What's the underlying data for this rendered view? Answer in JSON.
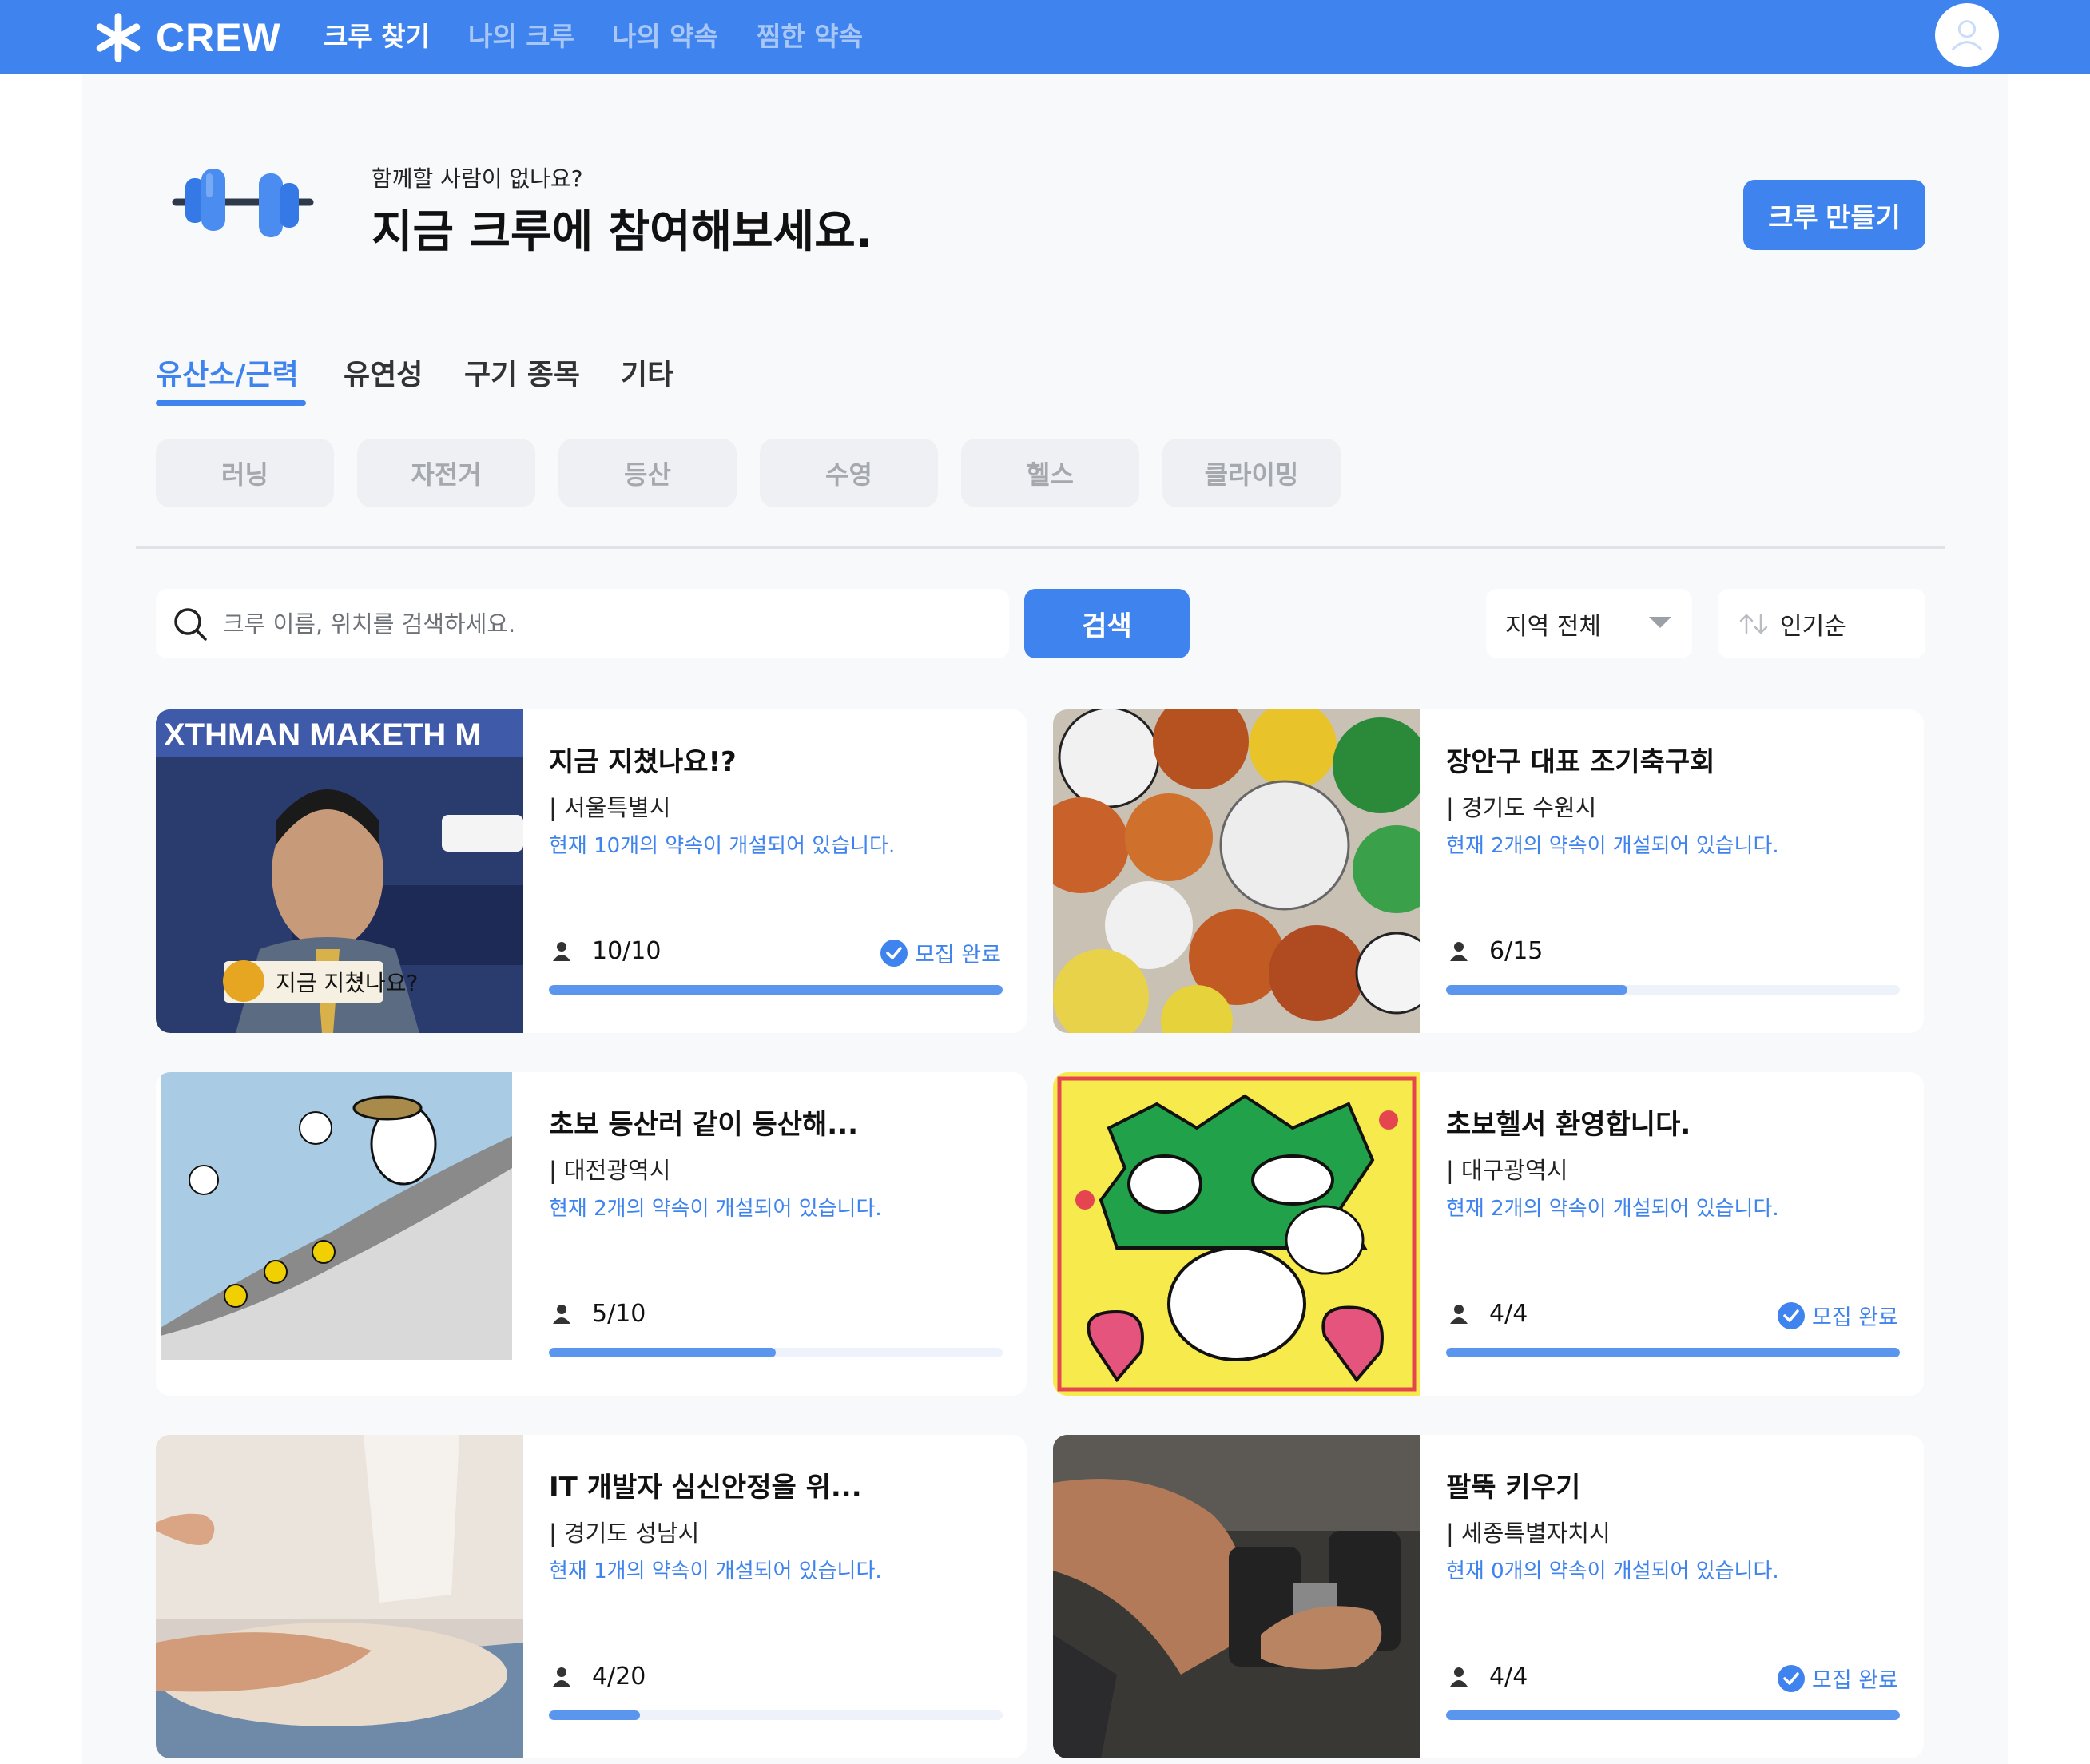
{
  "brand": {
    "name": "CREW",
    "accent": "#3f83ee"
  },
  "nav": {
    "items": [
      {
        "label": "크루 찾기",
        "active": true
      },
      {
        "label": "나의 크루",
        "active": false
      },
      {
        "label": "나의 약속",
        "active": false
      },
      {
        "label": "찜한 약속",
        "active": false
      }
    ]
  },
  "profile": {
    "icon": "user-avatar-icon"
  },
  "hero": {
    "subtitle": "함께할 사람이 없나요?",
    "title": "지금 크루에 참여해보세요.",
    "create_button": "크루 만들기",
    "icon": "dumbbell-icon"
  },
  "categories": {
    "tabs": [
      {
        "label": "유산소/근력",
        "active": true
      },
      {
        "label": "유연성",
        "active": false
      },
      {
        "label": "구기 종목",
        "active": false
      },
      {
        "label": "기타",
        "active": false
      }
    ],
    "chips": [
      "러닝",
      "자전거",
      "등산",
      "수영",
      "헬스",
      "클라이밍"
    ]
  },
  "search": {
    "placeholder": "크루 이름, 위치를 검색하세요.",
    "value": "",
    "button": "검색",
    "region": "지역 전체",
    "sort": "인기순"
  },
  "crews": [
    {
      "title": "지금 지쳤나요!?",
      "location": "| 서울특별시",
      "description": "현재 10개의 약속이 개설되어 있습니다.",
      "members": "10/10",
      "fill": 1.0,
      "status": "모집 완료",
      "closed": true,
      "image": "meme-image",
      "image_caption": "지금 지쳤나요?"
    },
    {
      "title": "장안구 대표 조기축구회",
      "location": "| 경기도 수원시",
      "description": "현재 2개의 약속이 개설되어 있습니다.",
      "members": "6/15",
      "fill": 0.4,
      "status": "",
      "closed": false,
      "image": "sports-balls-image"
    },
    {
      "title": "초보 등산러 같이 등산해...",
      "location": "| 대전광역시",
      "description": "현재 2개의 약속이 개설되어 있습니다.",
      "members": "5/10",
      "fill": 0.5,
      "status": "",
      "closed": false,
      "image": "snoopy-hiking-image"
    },
    {
      "title": "초보헬서 환영합니다.",
      "location": "| 대구광역시",
      "description": "현재 2개의 약속이 개설되어 있습니다.",
      "members": "4/4",
      "fill": 1.0,
      "status": "모집 완료",
      "closed": true,
      "image": "cartoon-cat-image"
    },
    {
      "title": "IT 개발자 심신안정을 위...",
      "location": "| 경기도 성남시",
      "description": "현재 1개의 약속이 개설되어 있습니다.",
      "members": "4/20",
      "fill": 0.2,
      "status": "",
      "closed": false,
      "image": "yoga-image"
    },
    {
      "title": "팔뚝 키우기",
      "location": "| 세종특별자치시",
      "description": "현재 0개의 약속이 개설되어 있습니다.",
      "members": "4/4",
      "fill": 1.0,
      "status": "모집 완료",
      "closed": true,
      "image": "dumbbell-workout-image"
    }
  ]
}
